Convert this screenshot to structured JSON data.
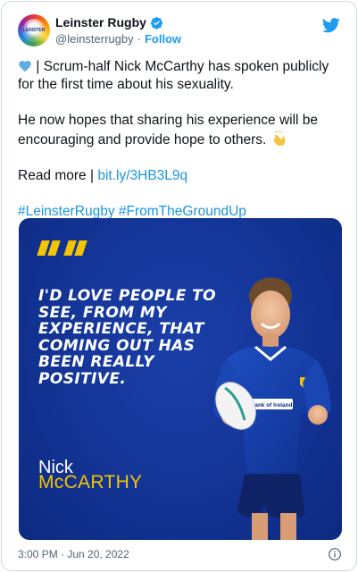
{
  "account": {
    "display_name": "Leinster Rugby",
    "handle": "@leinsterrugby",
    "separator": "·",
    "follow_label": "Follow",
    "avatar_text": "LEINSTER"
  },
  "tweet": {
    "line1": "| Scrum-half Nick McCarthy has spoken publicly for the first time about his sexuality.",
    "line2": "He now hopes that sharing his experience will be encouraging and provide hope to others.",
    "read_more": "Read more |",
    "link": "bit.ly/3HB3L9q",
    "hashtags": "#LeinsterRugby #FromTheGroundUp"
  },
  "media": {
    "quote": "I'd love people to see, from my experience, that coming out has been really positive.",
    "first_name": "Nick",
    "last_name": "McCARTHY",
    "jersey_text": "Bank of Ireland"
  },
  "footer": {
    "timestamp": "3:00 PM · Jun 20, 2022"
  },
  "colors": {
    "twitter_blue": "#1d9bf0",
    "leinster_blue": "#15369a",
    "accent_yellow": "#f5c400"
  },
  "icons": [
    "blue-heart-icon",
    "clapping-hands-icon",
    "verified-badge-icon",
    "twitter-bird-icon",
    "info-icon"
  ]
}
